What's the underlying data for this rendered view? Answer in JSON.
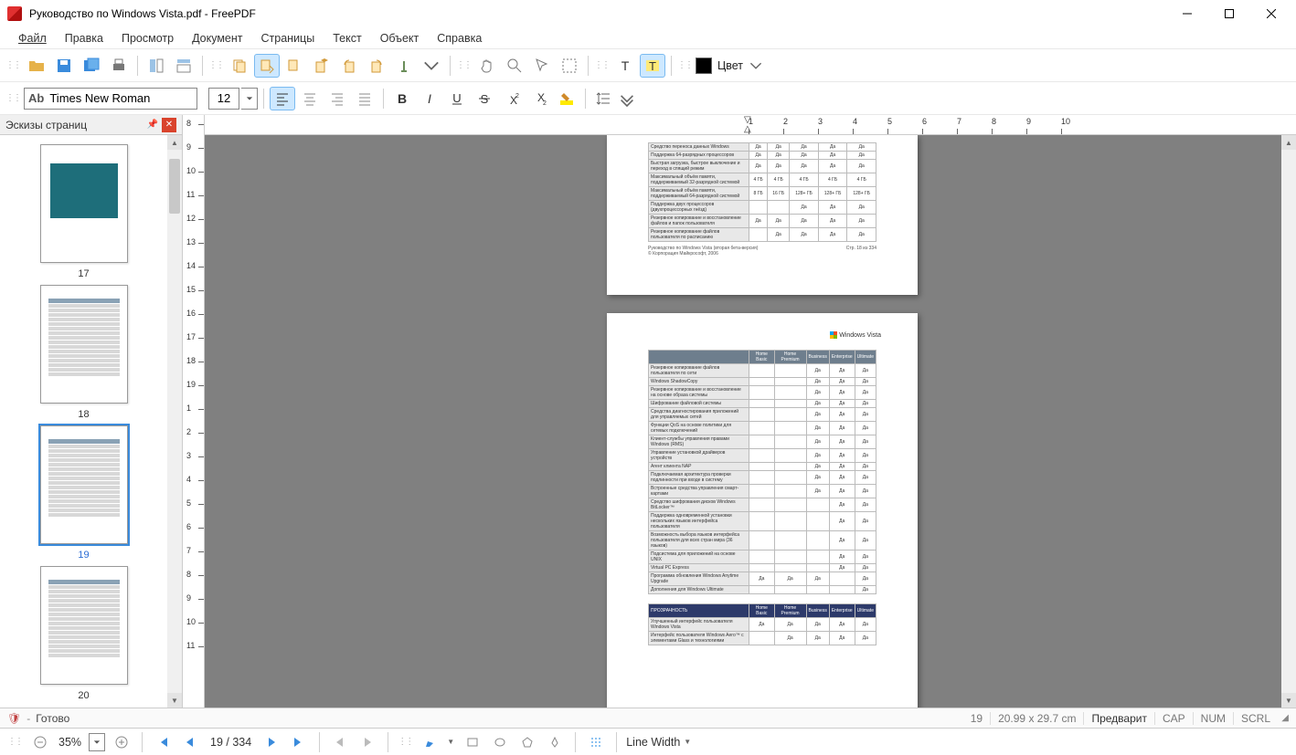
{
  "window": {
    "title": "Руководство по Windows Vista.pdf - FreePDF"
  },
  "menu": [
    "Файл",
    "Правка",
    "Просмотр",
    "Документ",
    "Страницы",
    "Текст",
    "Объект",
    "Справка"
  ],
  "toolbar1": {
    "color_label": "Цвет"
  },
  "toolbar2": {
    "font_name": "Times New Roman",
    "font_size": "12"
  },
  "sidebar": {
    "title": "Эскизы страниц",
    "thumbs": [
      {
        "num": "17",
        "selected": false,
        "variant": "page17"
      },
      {
        "num": "18",
        "selected": false,
        "variant": "table"
      },
      {
        "num": "19",
        "selected": true,
        "variant": "table"
      },
      {
        "num": "20",
        "selected": false,
        "variant": "table"
      }
    ]
  },
  "document": {
    "brand": "Windows Vista",
    "page_top_rows": [
      {
        "f": "Средство переноса данных Windows",
        "v": [
          "Да",
          "Да",
          "Да",
          "Да",
          "Да"
        ]
      },
      {
        "f": "Поддержка 64-разрядных процессоров",
        "v": [
          "Да",
          "Да",
          "Да",
          "Да",
          "Да"
        ]
      },
      {
        "f": "Быстрая загрузка, быстрое выключение и переход в спящий режим",
        "v": [
          "Да",
          "Да",
          "Да",
          "Да",
          "Да"
        ]
      },
      {
        "f": "Максимальный объём памяти, поддерживаемый 32-разрядной системой",
        "v": [
          "4 ГБ",
          "4 ГБ",
          "4 ГБ",
          "4 ГБ",
          "4 ГБ"
        ]
      },
      {
        "f": "Максимальный объём памяти, поддерживаемый 64-разрядной системой",
        "v": [
          "8 ГБ",
          "16 ГБ",
          "128+ ГБ",
          "128+ ГБ",
          "128+ ГБ"
        ]
      },
      {
        "f": "Поддержка двух процессоров (двухпроцессорных гнёзд)",
        "v": [
          "",
          "",
          "Да",
          "Да",
          "Да"
        ]
      },
      {
        "f": "Резервное копирование и восстановление файлов и папок пользователя",
        "v": [
          "Да",
          "Да",
          "Да",
          "Да",
          "Да"
        ]
      },
      {
        "f": "Резервное копирование файлов пользователя по расписанию",
        "v": [
          "",
          "Да",
          "Да",
          "Да",
          "Да"
        ]
      }
    ],
    "footer_left1": "Руководство по Windows Vista (вторая бета-версия)",
    "footer_left2": "© Корпорация Майкрософт, 2006",
    "footer_right": "Стр. 18 из 334",
    "headers": [
      "Home Basic",
      "Home Premium",
      "Business",
      "Enterprise",
      "Ultimate"
    ],
    "page19_rows": [
      {
        "f": "Резервное копирование файлов пользователя по сети",
        "v": [
          "",
          "",
          "Да",
          "Да",
          "Да"
        ]
      },
      {
        "f": "Windows ShadowCopy",
        "v": [
          "",
          "",
          "Да",
          "Да",
          "Да"
        ]
      },
      {
        "f": "Резервное копирование и восстановление на основе образа системы",
        "v": [
          "",
          "",
          "Да",
          "Да",
          "Да"
        ]
      },
      {
        "f": "Шифрование файловой системы",
        "v": [
          "",
          "",
          "Да",
          "Да",
          "Да"
        ]
      },
      {
        "f": "Средства диагностирования приложений для управляемых сетей",
        "v": [
          "",
          "",
          "Да",
          "Да",
          "Да"
        ]
      },
      {
        "f": "Функции QoS на основе политики для сетевых подключений",
        "v": [
          "",
          "",
          "Да",
          "Да",
          "Да"
        ]
      },
      {
        "f": "Клиент-службы управления правами Windows (RMS)",
        "v": [
          "",
          "",
          "Да",
          "Да",
          "Да"
        ]
      },
      {
        "f": "Управление установкой драйверов устройств",
        "v": [
          "",
          "",
          "Да",
          "Да",
          "Да"
        ]
      },
      {
        "f": "Агент клиента NAP",
        "v": [
          "",
          "",
          "Да",
          "Да",
          "Да"
        ]
      },
      {
        "f": "Подключаемая архитектура проверки подлинности при входе в систему",
        "v": [
          "",
          "",
          "Да",
          "Да",
          "Да"
        ]
      },
      {
        "f": "Встроенные средства управления смарт-картами",
        "v": [
          "",
          "",
          "Да",
          "Да",
          "Да"
        ]
      },
      {
        "f": "Средство шифрования дисков Windows BitLocker™",
        "v": [
          "",
          "",
          "",
          "Да",
          "Да"
        ]
      },
      {
        "f": "Поддержка одновременной установки нескольких языков интерфейса пользователя",
        "v": [
          "",
          "",
          "",
          "Да",
          "Да"
        ]
      },
      {
        "f": "Возможность выбора языков интерфейса пользователя для всех стран мира (36 языков)",
        "v": [
          "",
          "",
          "",
          "Да",
          "Да"
        ]
      },
      {
        "f": "Подсистема для приложений на основе UNIX",
        "v": [
          "",
          "",
          "",
          "Да",
          "Да"
        ]
      },
      {
        "f": "Virtual PC Express",
        "v": [
          "",
          "",
          "",
          "Да",
          "Да"
        ]
      },
      {
        "f": "Программа обновления Windows Anytime Upgrade",
        "v": [
          "Да",
          "Да",
          "Да",
          "",
          "Да"
        ]
      },
      {
        "f": "Дополнения для Windows Ultimate",
        "v": [
          "",
          "",
          "",
          "",
          "Да"
        ]
      }
    ],
    "section2_title": "ПРОЗРАЧНОСТЬ",
    "page19_rows2": [
      {
        "f": "Улучшенный интерфейс пользователя Windows Vista",
        "v": [
          "Да",
          "Да",
          "Да",
          "Да",
          "Да"
        ]
      },
      {
        "f": "Интерфейс пользователя Windows Aero™ с элементами Glass и технологиями",
        "v": [
          "",
          "Да",
          "Да",
          "Да",
          "Да"
        ]
      }
    ]
  },
  "status": {
    "ready": "Готово",
    "page_num": "19",
    "page_size": "20.99 x 29.7 cm",
    "preview": "Предварит",
    "cap": "CAP",
    "num": "NUM",
    "scrl": "SCRL"
  },
  "bottombar": {
    "zoom": "35%",
    "page_label": "19 / 334",
    "line_width": "Line Width"
  },
  "hruler_nums": [
    "1",
    "2",
    "3",
    "4",
    "5",
    "6",
    "7",
    "8",
    "9",
    "10"
  ],
  "vruler_nums": [
    "8",
    "9",
    "10",
    "11",
    "12",
    "13",
    "14",
    "15",
    "16",
    "17",
    "18",
    "19",
    "1",
    "2",
    "3",
    "4",
    "5",
    "6",
    "7",
    "8",
    "9",
    "10",
    "11"
  ]
}
